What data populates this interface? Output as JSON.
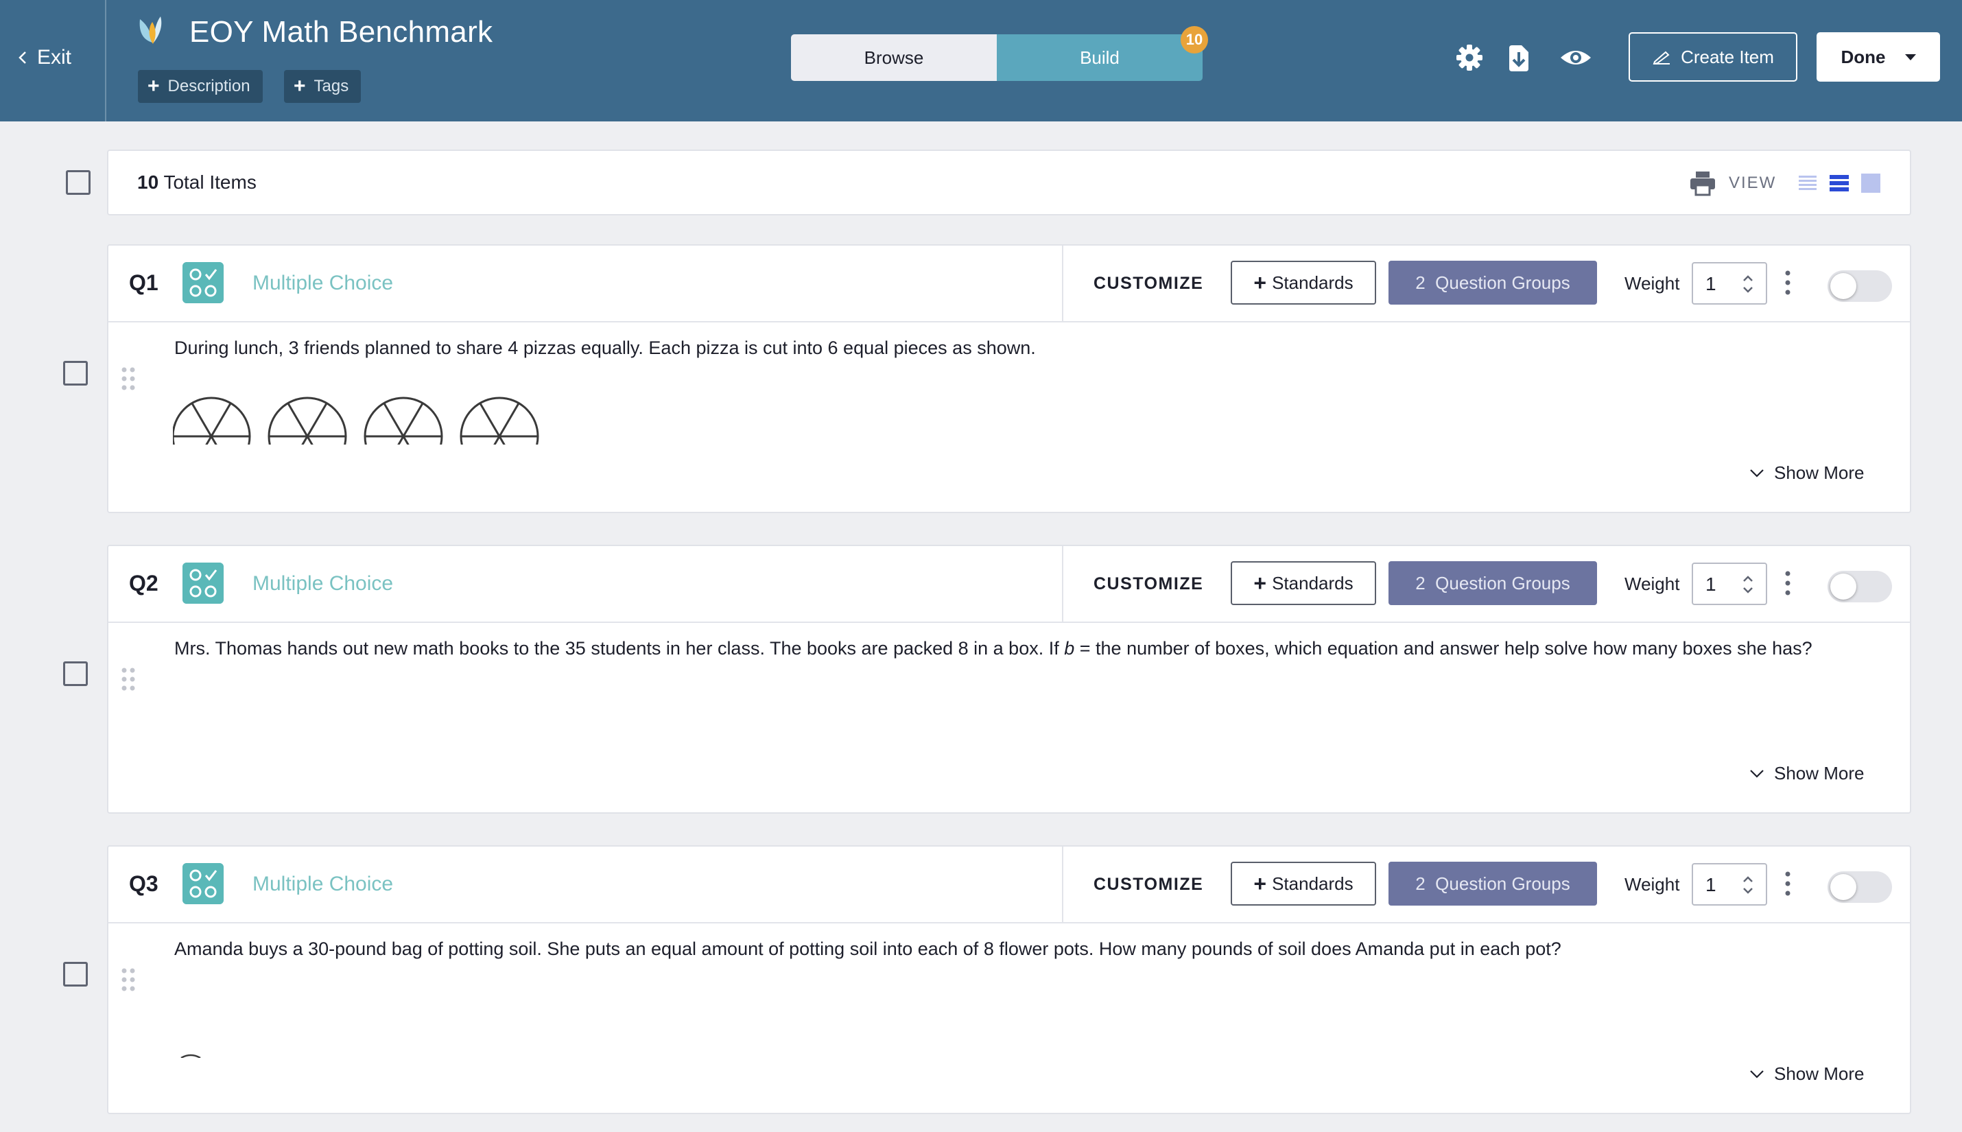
{
  "header": {
    "exit_label": "Exit",
    "title": "EOY Math Benchmark",
    "description_label": "Description",
    "tags_label": "Tags",
    "tabs": [
      {
        "label": "Browse",
        "active": false
      },
      {
        "label": "Build",
        "active": true
      }
    ],
    "build_badge": "10",
    "icons": [
      "gear-icon",
      "download-icon",
      "eye-icon"
    ],
    "create_item_label": "Create Item",
    "done_label": "Done",
    "colors": {
      "bar": "#3d6a8c",
      "build_tab": "#5ba7bd",
      "badge": "#e8a33a"
    }
  },
  "summary": {
    "total_count": "10",
    "total_label": "Total Items",
    "view_label": "VIEW",
    "view_modes": [
      "list-compact-icon",
      "list-expanded-icon",
      "grid-icon"
    ]
  },
  "questions": [
    {
      "number": "Q1",
      "type": "Multiple Choice",
      "customize_label": "CUSTOMIZE",
      "standards_label": "Standards",
      "groups_label": "2  Question Groups",
      "weight_label": "Weight",
      "weight_value": "1",
      "enabled": false,
      "text": "During lunch, 3 friends planned to share 4 pizzas equally. Each pizza is cut into 6 equal pieces as shown.",
      "show_more_label": "Show More"
    },
    {
      "number": "Q2",
      "type": "Multiple Choice",
      "customize_label": "CUSTOMIZE",
      "standards_label": "Standards",
      "groups_label": "2  Question Groups",
      "weight_label": "Weight",
      "weight_value": "1",
      "enabled": false,
      "text_before": "Mrs. Thomas hands out new math books to the 35 students in her class. The books are packed 8 in a box. If ",
      "text_var": "b",
      "text_after": " = the number of boxes, which equation and answer help solve how many boxes she has?",
      "show_more_label": "Show More"
    },
    {
      "number": "Q3",
      "type": "Multiple Choice",
      "customize_label": "CUSTOMIZE",
      "standards_label": "Standards",
      "groups_label": "2  Question Groups",
      "weight_label": "Weight",
      "weight_value": "1",
      "enabled": false,
      "text": "Amanda buys a 30-pound bag of potting soil. She puts an equal amount of potting soil into each of 8 flower pots. How many pounds of soil does Amanda put in each pot?",
      "show_more_label": "Show More"
    }
  ]
}
